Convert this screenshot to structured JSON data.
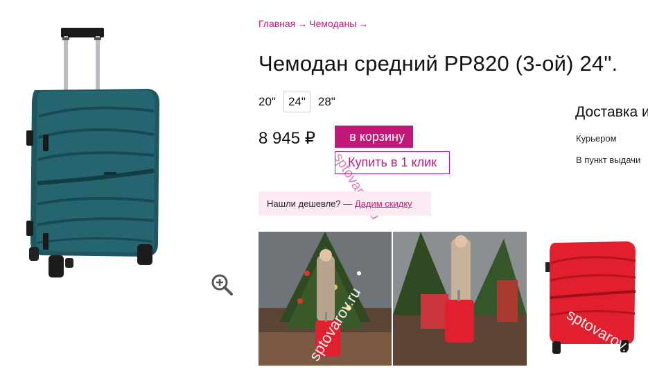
{
  "breadcrumb": {
    "home": "Главная",
    "category": "Чемоданы",
    "arrow": "→"
  },
  "product": {
    "title": "Чемодан средний PP820 (3-ой) 24\".",
    "sizes": [
      "20\"",
      "24\"",
      "28\""
    ],
    "selected_size": "24\"",
    "price": "8 945 ₽"
  },
  "actions": {
    "cart": "в корзину",
    "one_click": "Купить в 1 клик"
  },
  "delivery": {
    "title": "Доставка и",
    "courier": "Курьером",
    "pickup": "В пункт выдачи"
  },
  "cheaper": {
    "text": "Нашли дешевле? —",
    "link": "Дадим скидку"
  },
  "watermark": "sptovarov.ru",
  "colors": {
    "accent": "#c2187a",
    "suitcase_main": "#1f5a62",
    "suitcase_thumb": "#e02a35",
    "tint": "#fbeaf4"
  },
  "icons": {
    "zoom": "magnifier-plus-icon"
  }
}
